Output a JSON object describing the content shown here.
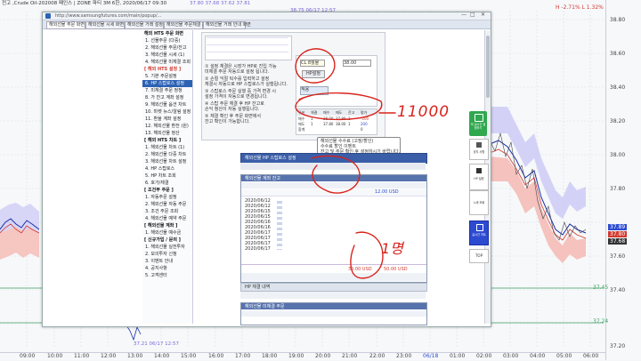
{
  "chart": {
    "header_left": "전고 ,Crude Oil-202008 페인스 | ZONE 파티 3M 6한, 2020/06/17 09:30",
    "header_mid": "37.80 37.68 37.62 37.81",
    "header_right": "H -2.71% L 1.32%",
    "top_marker": "38.75 06/17 12:57",
    "bottom_marker": "37.21 06/17 12:57",
    "price_labels": [
      "38.80",
      "38.60",
      "38.40",
      "38.20",
      "38.00",
      "37.80",
      "37.60",
      "37.40",
      "37.20"
    ],
    "right_tags": [
      "37.89",
      "37.80",
      "37.68"
    ],
    "level_labels": [
      "37.45",
      "37.24"
    ],
    "time_labels": [
      "09:00",
      "10:00",
      "11:00",
      "12:00",
      "13:00",
      "14:00",
      "15:00",
      "16:00",
      "17:00",
      "18:00",
      "19:00",
      "20:00",
      "21:00",
      "22:00",
      "23:00",
      "06/18",
      "01:00",
      "02:00",
      "03:00",
      "04:00",
      "05:00",
      "06:00",
      "07:00"
    ],
    "colors": {
      "band_upper": "#c9c8f5",
      "band_lower": "#f5b9b3",
      "line_blue": "#1c2fa8",
      "line_red": "#d23a30",
      "candle": "#d44"
    }
  },
  "browser": {
    "url": "http://www.samsungfutures.com/main/popup/..."
  },
  "tabs": [
    {
      "label": "해외선물 주문 화면"
    },
    {
      "label": "해외선물 시세 화면"
    },
    {
      "label": "해외선물 거래 설정"
    },
    {
      "label": "해외선물 주문체결 조회"
    },
    {
      "label": "해외선물 거래 안내 화면"
    }
  ],
  "menu": [
    {
      "type": "head",
      "label": "해외 HTS 주문 화면"
    },
    {
      "type": "item",
      "label": "1. 선물주문 (다중)"
    },
    {
      "type": "item",
      "label": "2. 해외선물 주문/잔고"
    },
    {
      "type": "item",
      "label": "3. 해외선물 시세 (1)"
    },
    {
      "type": "item",
      "label": "4. 해외선물 미체결 조회"
    },
    {
      "type": "head",
      "label": "[ 해외 HTS 설정 ]"
    },
    {
      "type": "item",
      "label": "5. 기본 주문설정"
    },
    {
      "type": "item",
      "label": "6. HP 스탑로스 설정",
      "selected": true
    },
    {
      "type": "item",
      "label": "7. 미체결 주문 정정"
    },
    {
      "type": "item",
      "label": "8. 가 잔고 계좌 설정"
    },
    {
      "type": "item",
      "label": "9. 해외선물 옵션 차트"
    },
    {
      "type": "item",
      "label": "10. 마켓 뉴스/알림 설정"
    },
    {
      "type": "item",
      "label": "11. 환율 계좌 설정"
    },
    {
      "type": "item",
      "label": "12. 해외선물 환전 (원)"
    },
    {
      "type": "item",
      "label": "13. 해외선물 정산"
    },
    {
      "type": "head",
      "label": "[ 해외 HTS 차트 ]"
    },
    {
      "type": "item",
      "label": "1. 해외선물 차트 (1)"
    },
    {
      "type": "item",
      "label": "2. 해외선물 다중 차트"
    },
    {
      "type": "item",
      "label": "3. 해외선물 차트 설정"
    },
    {
      "type": "item",
      "label": "4. HP 스탑로스"
    },
    {
      "type": "item",
      "label": "5. HP 차트 조회"
    },
    {
      "type": "item",
      "label": "6. 호가/체결"
    },
    {
      "type": "head",
      "label": "[ 조건부 주문 ]"
    },
    {
      "type": "item",
      "label": "1. 자동주문 설정"
    },
    {
      "type": "item",
      "label": "2. 해외선물 자동 주문"
    },
    {
      "type": "item",
      "label": "3. 조건 주문 조회"
    },
    {
      "type": "item",
      "label": "4. 해외선물 예약 주문"
    },
    {
      "type": "head",
      "label": "[ 해외선물 계좌 ]"
    },
    {
      "type": "item",
      "label": "1. 해외선물 예수금"
    },
    {
      "type": "head",
      "label": "[ 신규가입 / 문의 ]"
    },
    {
      "type": "item",
      "label": "1. 해외선물 실전투자"
    },
    {
      "type": "item",
      "label": "2. 모의투자 신청"
    },
    {
      "type": "item",
      "label": "3. 이벤트 안내"
    },
    {
      "type": "item",
      "label": "4. 공지사항"
    },
    {
      "type": "item",
      "label": "5. 고객센터"
    }
  ],
  "panel_text": [
    "① 설정 체결은 시장가 HP로 진입 가능",
    "미체결 주문 자동으로 설정 됩니다.",
    "② 손절 익절 틱수를 입력하고 설정",
    "체결시 자동으로 HP 스탑로스가 실행됩니다.",
    "③ 스탑로스 주문 실행 중 가격 변경 시",
    "설정 가격이 자동으로 변경됩니다.",
    "④ 스탑 주문 체결 후 HP 잔고로",
    "손익 청산이 자동 실행됩니다.",
    "⑤ 체결 확인 후 주문 화면에서",
    "잔고 확인이 가능합니다."
  ],
  "balloon_text": [
    "해외선물 수수료 (고정/할인)",
    "수수료 할인 이벤트",
    "잔고 및 주문 확인 후 설정하시기 바랍니다."
  ],
  "form": {
    "field1": "CL 8월물",
    "field2": "38.00",
    "btn1": "HP설정",
    "btn2": "적용"
  },
  "grid_headers": [
    "구분",
    "체결",
    "매수",
    "매도",
    "잔고",
    "평가"
  ],
  "grid_rows": [
    [
      "매수",
      "1",
      "38.00",
      "37.80",
      "1",
      "-200"
    ],
    [
      "매도",
      "1",
      "37.80",
      "38.00",
      "1",
      "200"
    ],
    [
      "합계",
      "",
      "",
      "",
      "",
      "0"
    ]
  ],
  "list_dates": [
    "2020/06/12",
    "2020/06/12",
    "2020/06/15",
    "2020/06/15",
    "2020/06/16",
    "2020/06/16",
    "2020/06/17",
    "2020/06/17",
    "2020/06/17",
    "2020/06/17"
  ],
  "totals": [
    "12.00 USD",
    "30.00 USD",
    "50.00 USD"
  ],
  "section_titles": [
    "해외선물 HP 스탑로스 설정",
    "해외선물 계좌 잔고",
    "HP 체결 내역",
    "해외선물 미체결 주문"
  ],
  "annotations": {
    "amount": "11000",
    "count": "1명"
  },
  "right_buttons": [
    {
      "label": "미 실시간 설정하기",
      "color": "#2fa84f"
    },
    {
      "label": "공지 사항"
    },
    {
      "label": "HP 설정"
    },
    {
      "label": "시세 조회"
    },
    {
      "label": "실시간 차트"
    },
    {
      "label": "전자 기능"
    },
    {
      "label": "TOP"
    }
  ]
}
